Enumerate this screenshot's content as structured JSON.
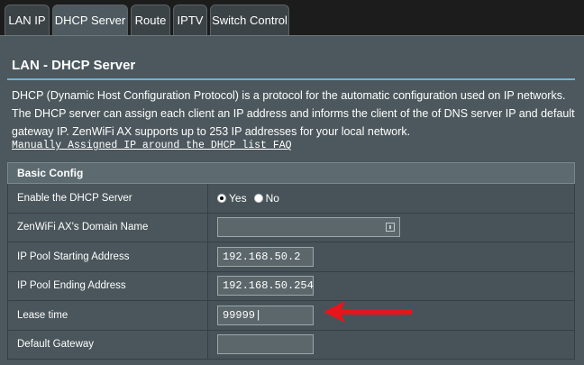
{
  "tabs": [
    {
      "label": "LAN IP",
      "active": false
    },
    {
      "label": "DHCP Server",
      "active": true
    },
    {
      "label": "Route",
      "active": false
    },
    {
      "label": "IPTV",
      "active": false
    },
    {
      "label": "Switch Control",
      "active": false
    }
  ],
  "page": {
    "title": "LAN - DHCP Server",
    "description": "DHCP (Dynamic Host Configuration Protocol) is a protocol for the automatic configuration used on IP networks. The DHCP server can assign each client an IP address and informs the client of the of DNS server IP and default gateway IP. ZenWiFi AX supports up to 253 IP addresses for your local network.",
    "faq_link": "Manually Assigned IP around the DHCP list FAQ"
  },
  "basic_config": {
    "header": "Basic Config",
    "enable_dhcp": {
      "label": "Enable the DHCP Server",
      "yes": "Yes",
      "no": "No",
      "selected": "Yes"
    },
    "domain_name": {
      "label": "ZenWiFi AX's Domain Name",
      "value": ""
    },
    "pool_start": {
      "label": "IP Pool Starting Address",
      "value": "192.168.50.2"
    },
    "pool_end": {
      "label": "IP Pool Ending Address",
      "value": "192.168.50.254"
    },
    "lease_time": {
      "label": "Lease time",
      "value": "99999|"
    },
    "gateway": {
      "label": "Default Gateway",
      "value": ""
    }
  },
  "colors": {
    "accent_divider": "#71b3d7",
    "arrow": "#e8141c"
  }
}
